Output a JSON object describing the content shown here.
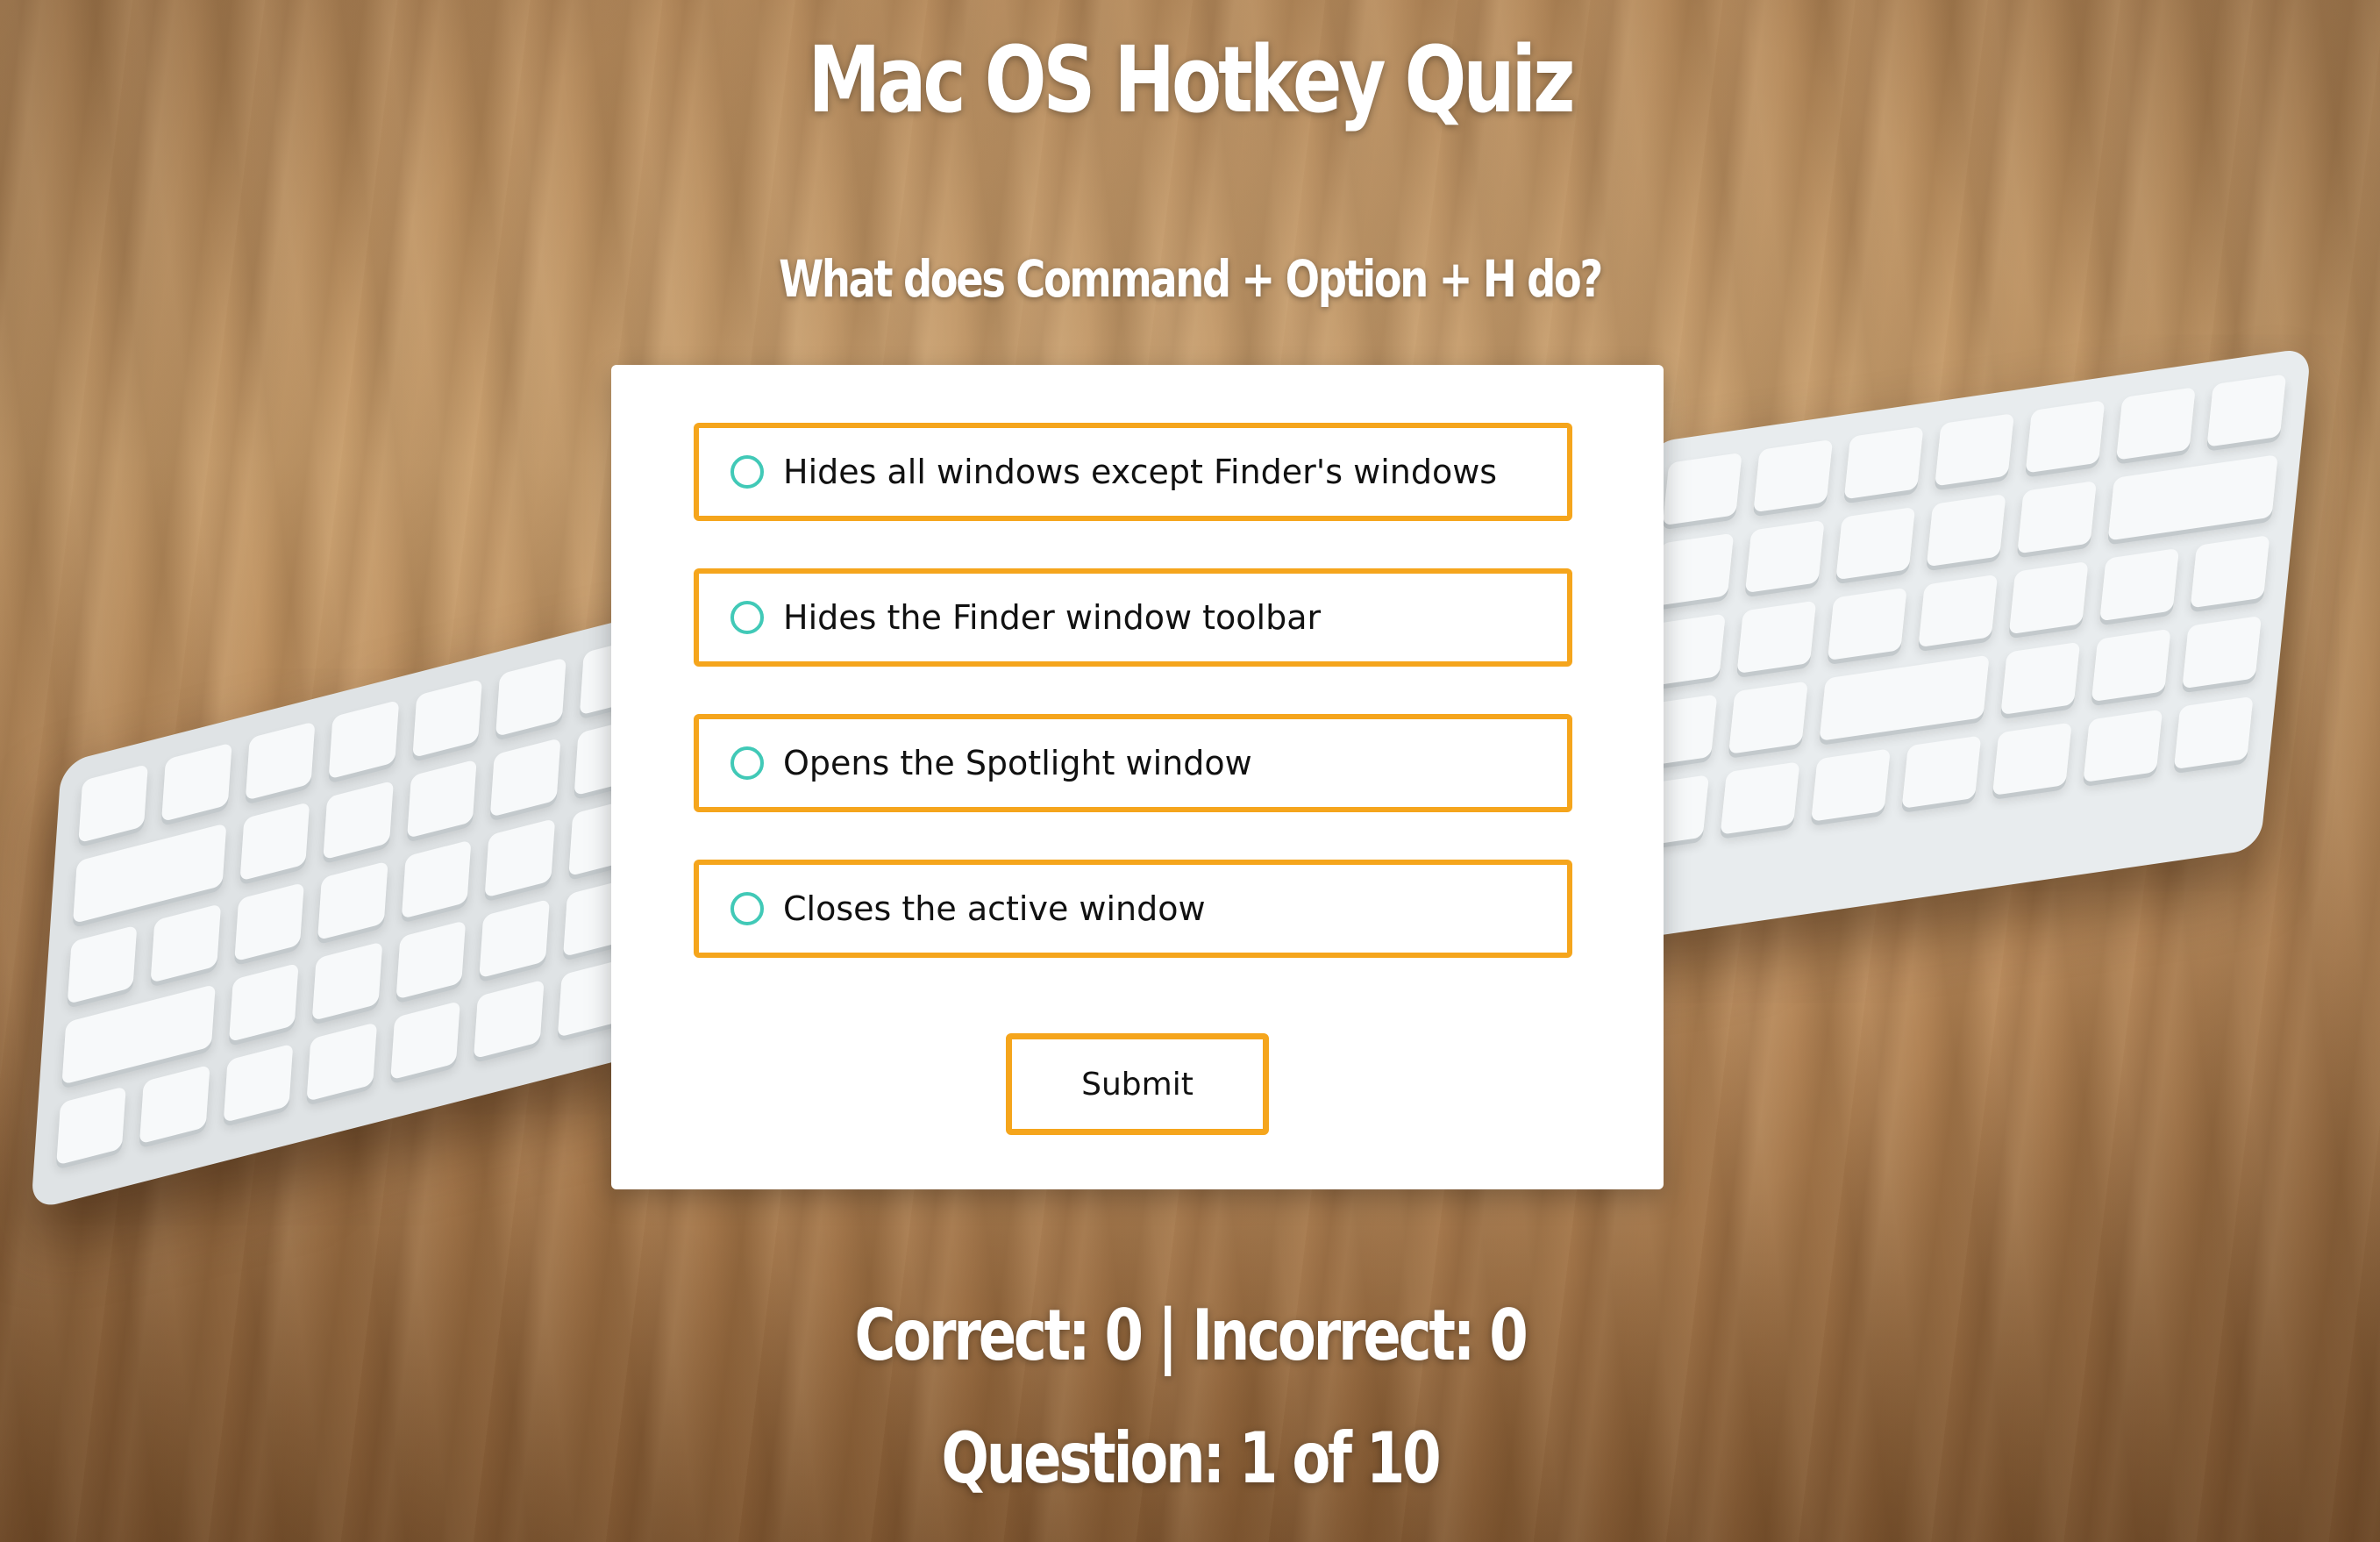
{
  "page": {
    "title": "Mac OS Hotkey Quiz",
    "question": "What does Command + Option + H do?"
  },
  "options": [
    {
      "label": "Hides all windows except Finder's windows",
      "selected": false
    },
    {
      "label": "Hides the Finder window toolbar",
      "selected": false
    },
    {
      "label": "Opens the Spotlight window",
      "selected": false
    },
    {
      "label": "Closes the active window",
      "selected": false
    }
  ],
  "submit_label": "Submit",
  "score": {
    "text": "Correct: 0 | Incorrect: 0",
    "correct": 0,
    "incorrect": 0
  },
  "progress": {
    "text": "Question: 1 of 10",
    "current": 1,
    "total": 10
  },
  "colors": {
    "accent_border": "#f5a51c",
    "radio": "#41c9b7",
    "heading_text": "#ffffff",
    "card": "#ffffff"
  },
  "background": {
    "image": "keyboard-on-wooden-desk"
  }
}
